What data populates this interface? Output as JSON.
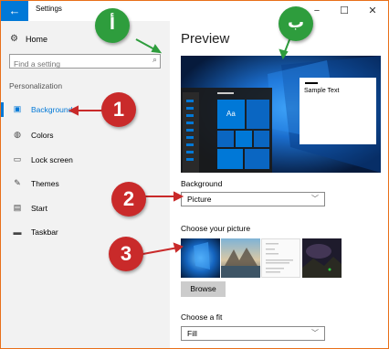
{
  "window": {
    "back_glyph": "←",
    "title": "Settings",
    "min_glyph": "−",
    "max_glyph": "☐",
    "close_glyph": "✕"
  },
  "sidebar": {
    "home_label": "Home",
    "search_placeholder": "Find a setting",
    "section_label": "Personalization",
    "items": [
      {
        "label": "Background",
        "icon": "picture-icon",
        "active": true
      },
      {
        "label": "Colors",
        "icon": "palette-icon"
      },
      {
        "label": "Lock screen",
        "icon": "lock-screen-icon"
      },
      {
        "label": "Themes",
        "icon": "brush-icon"
      },
      {
        "label": "Start",
        "icon": "start-icon"
      },
      {
        "label": "Taskbar",
        "icon": "taskbar-icon"
      }
    ]
  },
  "main": {
    "title": "Preview",
    "preview_sample_text": "Sample Text",
    "preview_tile_text": "Aa",
    "background_label": "Background",
    "background_value": "Picture",
    "choose_picture_label": "Choose your picture",
    "browse_label": "Browse",
    "fit_label": "Choose a fit",
    "fit_value": "Fill"
  },
  "annotations": {
    "badge_1": "1",
    "badge_2": "2",
    "badge_3": "3",
    "badge_alef": "أ",
    "badge_ba": "ب"
  },
  "colors": {
    "accent": "#0078d7",
    "annotation_red": "#c92a2a",
    "annotation_green": "#2e9d3d",
    "frame_border": "#e8701a"
  }
}
